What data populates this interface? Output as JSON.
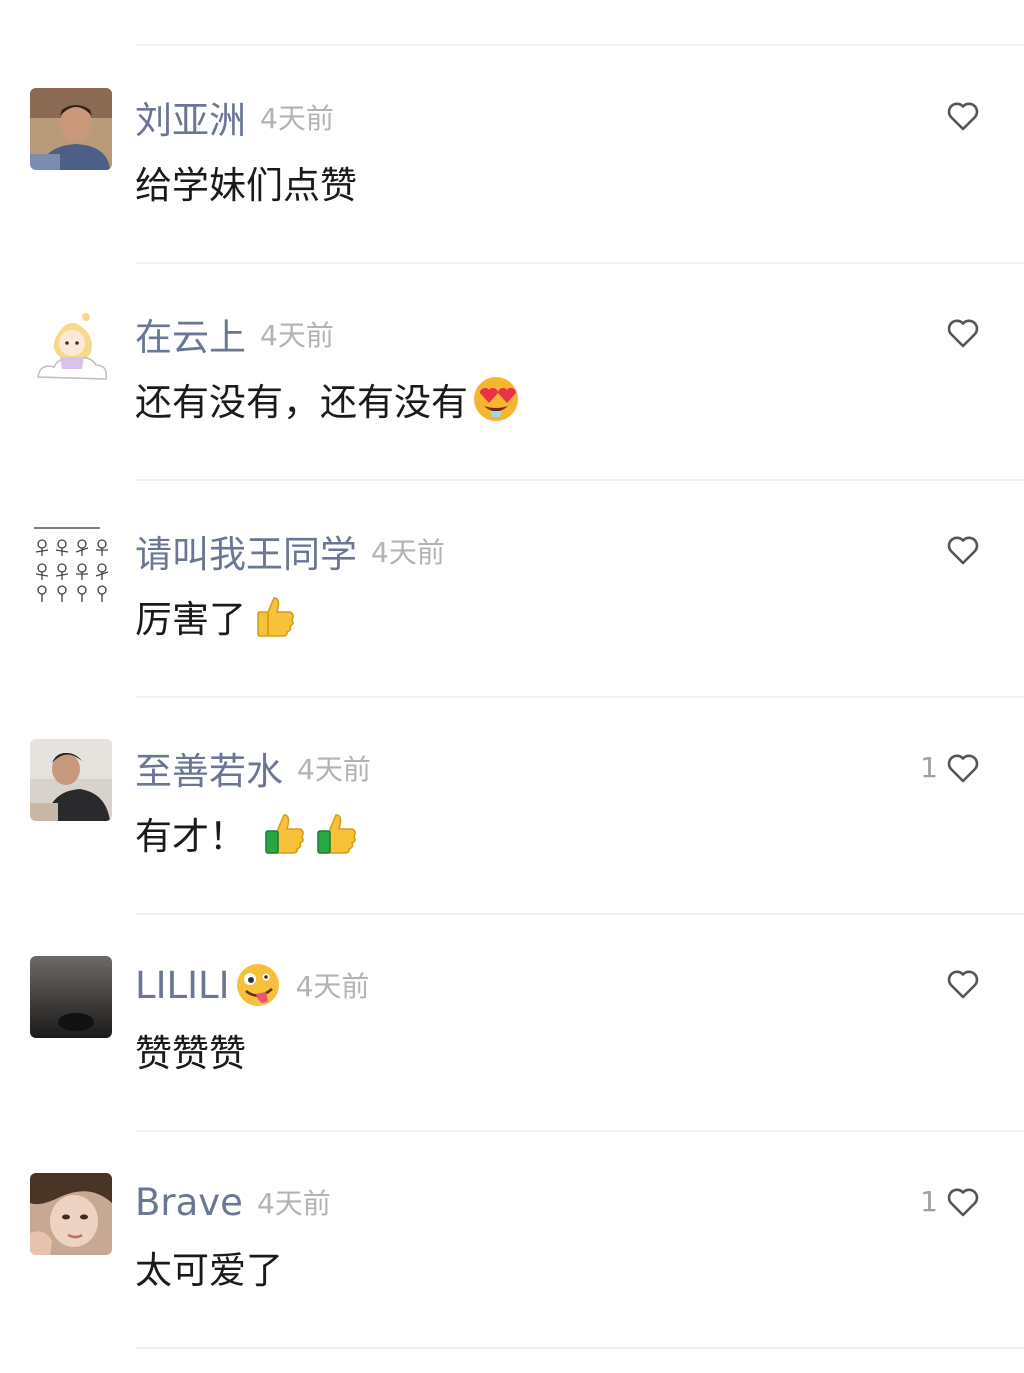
{
  "comments": [
    {
      "name": "刘亚洲",
      "time": "4天前",
      "text": "给学妹们点赞",
      "likes": ""
    },
    {
      "name": "在云上",
      "time": "4天前",
      "text": "还有没有，还有没有",
      "likes": ""
    },
    {
      "name": "请叫我王同学",
      "time": "4天前",
      "text": "厉害了",
      "likes": ""
    },
    {
      "name": "至善若水",
      "time": "4天前",
      "text": "有才！",
      "likes": "1"
    },
    {
      "name": "LILILI",
      "time": "4天前",
      "text": "赞赞赞",
      "likes": ""
    },
    {
      "name": "Brave",
      "time": "4天前",
      "text": "太可爱了",
      "likes": "1"
    }
  ],
  "icons": {
    "like": "heart-outline-icon",
    "emoji_heart_eyes": "heart-eyes-emoji",
    "emoji_thumbs_up": "thumbs-up-emoji",
    "emoji_zany": "zany-face-emoji"
  },
  "colors": {
    "name": "#6b7694",
    "time": "#b3b3b3",
    "text": "#1a1a1a",
    "divider": "#efefef"
  }
}
